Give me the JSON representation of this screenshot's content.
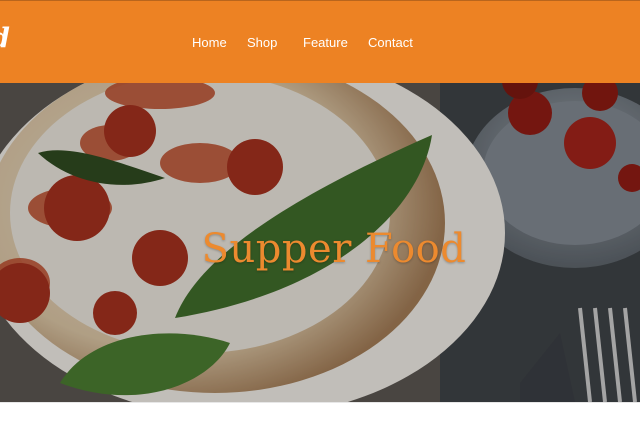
{
  "brand": {
    "logo_text": "d"
  },
  "nav": {
    "items": [
      {
        "label": "Home"
      },
      {
        "label": "Shop"
      },
      {
        "label": "Feature"
      },
      {
        "label": "Contact"
      }
    ]
  },
  "hero": {
    "title": "Supper Food",
    "image": "pizza-with-basil-and-tomatoes-photo"
  },
  "colors": {
    "header_bg": "#ed8223",
    "title_text": "#ec8a2f",
    "nav_text": "#ffffff"
  }
}
